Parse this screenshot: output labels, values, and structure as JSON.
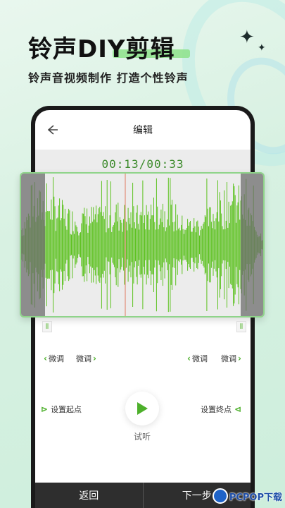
{
  "promo": {
    "headline_prefix": "铃声",
    "headline_diy": "DIY",
    "headline_suffix": "剪辑",
    "subline": "铃声音视频制作 打造个性铃声"
  },
  "editor": {
    "title": "编辑",
    "time_display": "00:13/00:33",
    "fine_tune_left_1": "微调",
    "fine_tune_left_2": "微调",
    "fine_tune_right_1": "微调",
    "fine_tune_right_2": "微调",
    "set_start": "设置起点",
    "set_end": "设置终点",
    "preview_label": "试听"
  },
  "bottom_bar": {
    "back_label": "返回",
    "next_label": "下一步"
  },
  "watermark": {
    "text": "PCPOP下载"
  },
  "colors": {
    "accent_green": "#4db02b",
    "wave_green": "#5cc21f",
    "time_green": "#3b8a2a",
    "playhead": "#e07a5f"
  }
}
